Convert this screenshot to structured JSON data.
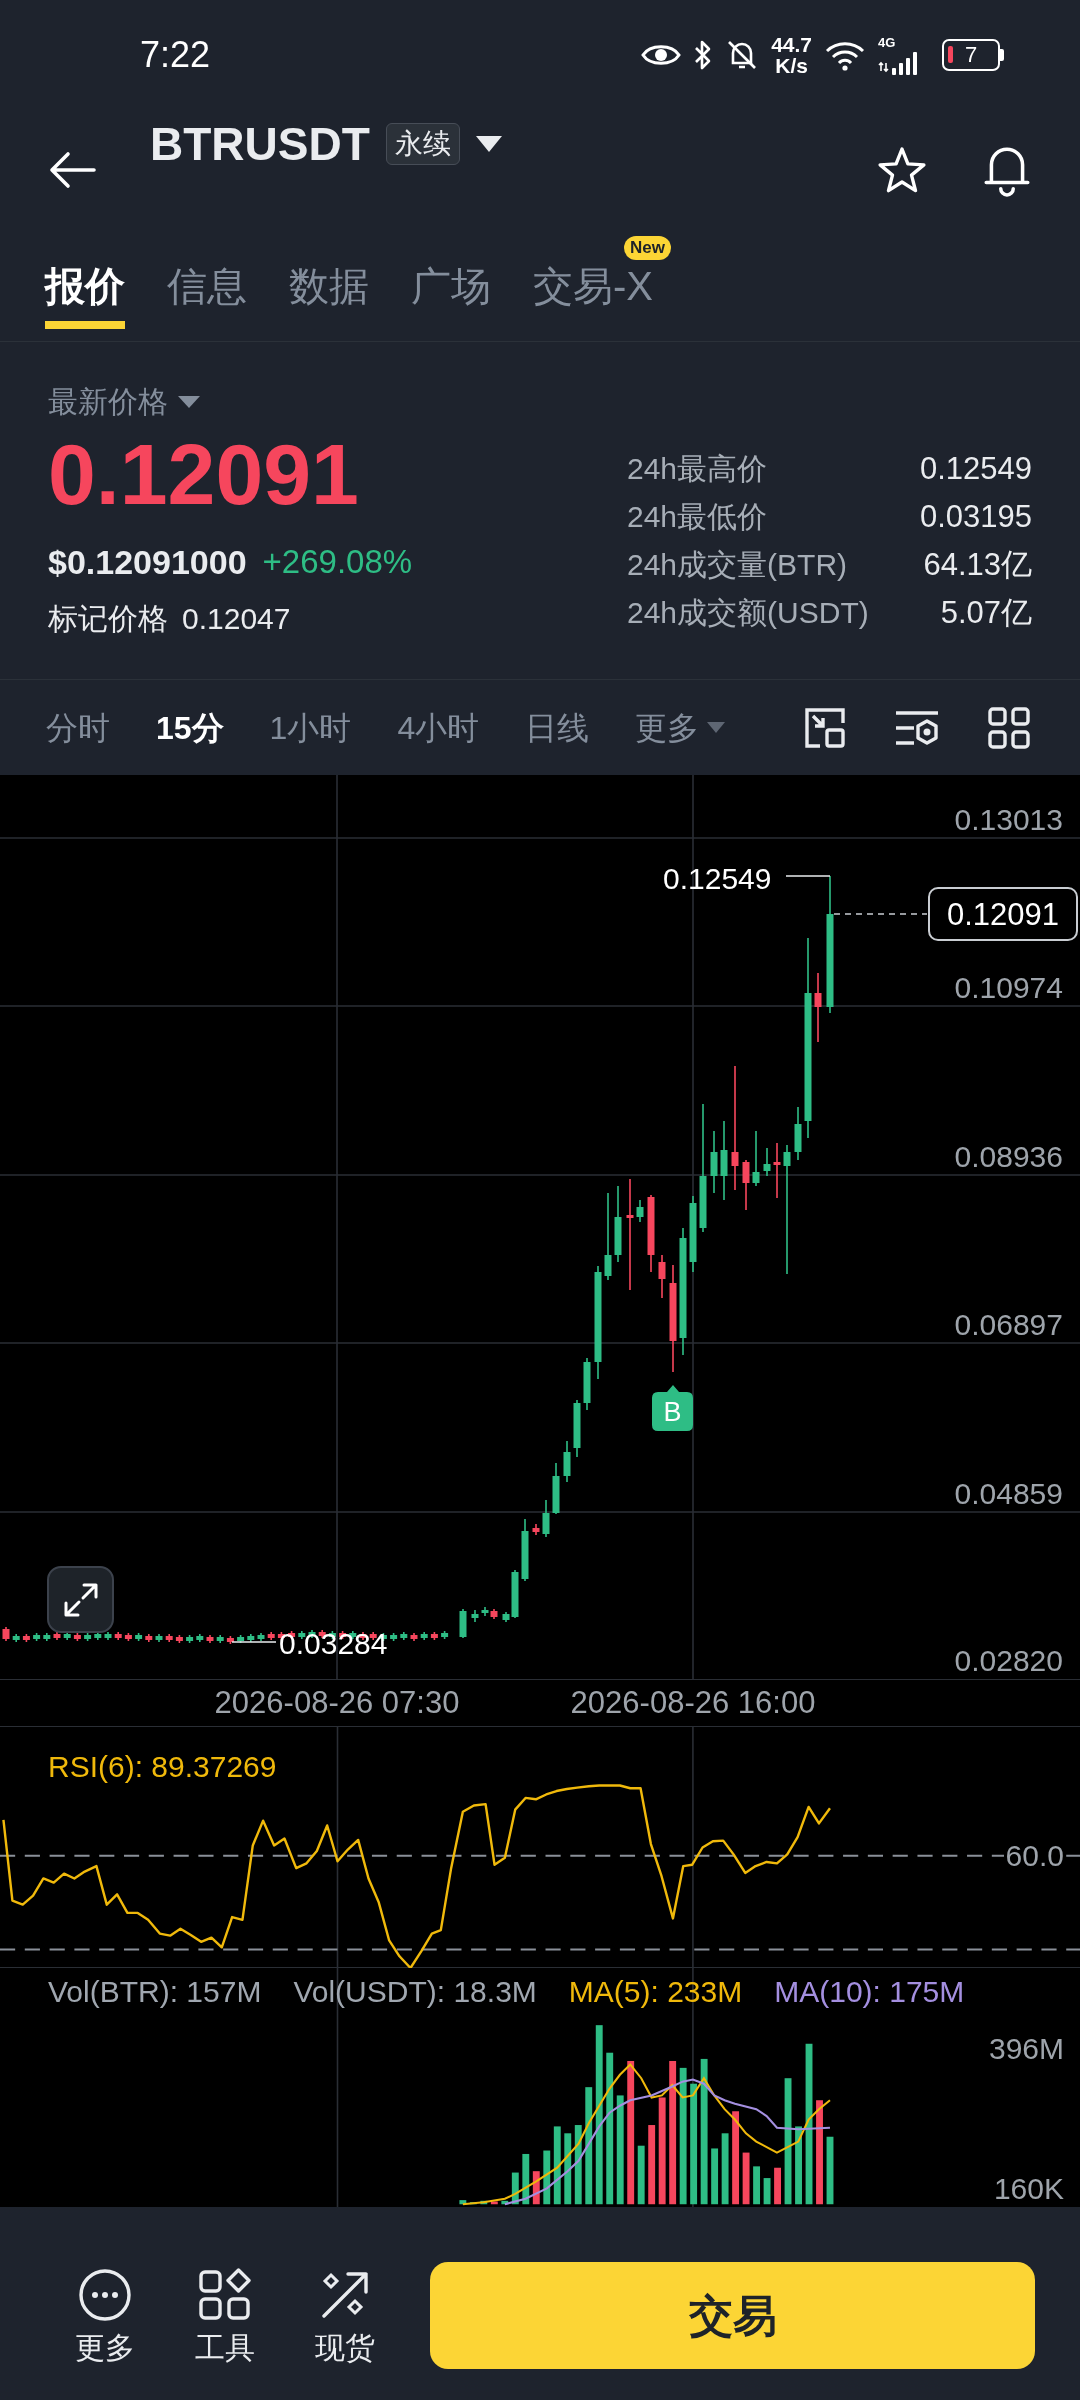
{
  "status_bar": {
    "time": "7:22",
    "net_speed": "44.7",
    "net_speed_unit": "K/s",
    "network_type": "4G",
    "battery": "7"
  },
  "header": {
    "symbol": "BTRUSDT",
    "contract_badge": "永续"
  },
  "tabs": [
    {
      "label": "报价",
      "selected": true
    },
    {
      "label": "信息",
      "selected": false
    },
    {
      "label": "数据",
      "selected": false
    },
    {
      "label": "广场",
      "selected": false
    },
    {
      "label": "交易-X",
      "selected": false,
      "badge": "New"
    }
  ],
  "price_panel": {
    "price_type": "最新价格",
    "last_price": "0.12091",
    "usd_price": "$0.12091000",
    "change": "+269.08%",
    "mark_price_label": "标记价格",
    "mark_price": "0.12047",
    "stats": [
      {
        "label": "24h最高价",
        "value": "0.12549"
      },
      {
        "label": "24h最低价",
        "value": "0.03195"
      },
      {
        "label": "24h成交量(BTR)",
        "value": "64.13亿"
      },
      {
        "label": "24h成交额(USDT)",
        "value": "5.07亿"
      }
    ]
  },
  "intervals": [
    {
      "label": "分时",
      "selected": false,
      "kind": "option"
    },
    {
      "label": "15分",
      "selected": true,
      "kind": "option"
    },
    {
      "label": "1小时",
      "selected": false,
      "kind": "option"
    },
    {
      "label": "4小时",
      "selected": false,
      "kind": "option"
    },
    {
      "label": "日线",
      "selected": false,
      "kind": "option"
    },
    {
      "label": "更多",
      "selected": false,
      "kind": "menu"
    }
  ],
  "chart": {
    "price_axis": [
      "0.13013",
      "0.10974",
      "0.08936",
      "0.06897",
      "0.04859",
      "0.02820"
    ],
    "time_axis": [
      "2026-08-26 07:30",
      "2026-08-26 16:00"
    ],
    "high_marker": "0.12549",
    "low_marker": "0.03284",
    "last_price_tag": "0.12091",
    "trade_marker": "B"
  },
  "rsi": {
    "legend": "RSI(6): 89.37269",
    "level_label": "60.0"
  },
  "volume": {
    "legends": [
      {
        "text": "Vol(BTR): 157M",
        "color": "#a0a7b0"
      },
      {
        "text": "Vol(USDT): 18.3M",
        "color": "#a0a7b0"
      },
      {
        "text": "MA(5): 233M",
        "color": "#f0b90b"
      },
      {
        "text": "MA(10): 175M",
        "color": "#a48fe0"
      }
    ],
    "axis": [
      "396M",
      "160K"
    ]
  },
  "bottom_bar": {
    "actions": [
      "更多",
      "工具",
      "现货"
    ],
    "trade_button": "交易"
  }
}
